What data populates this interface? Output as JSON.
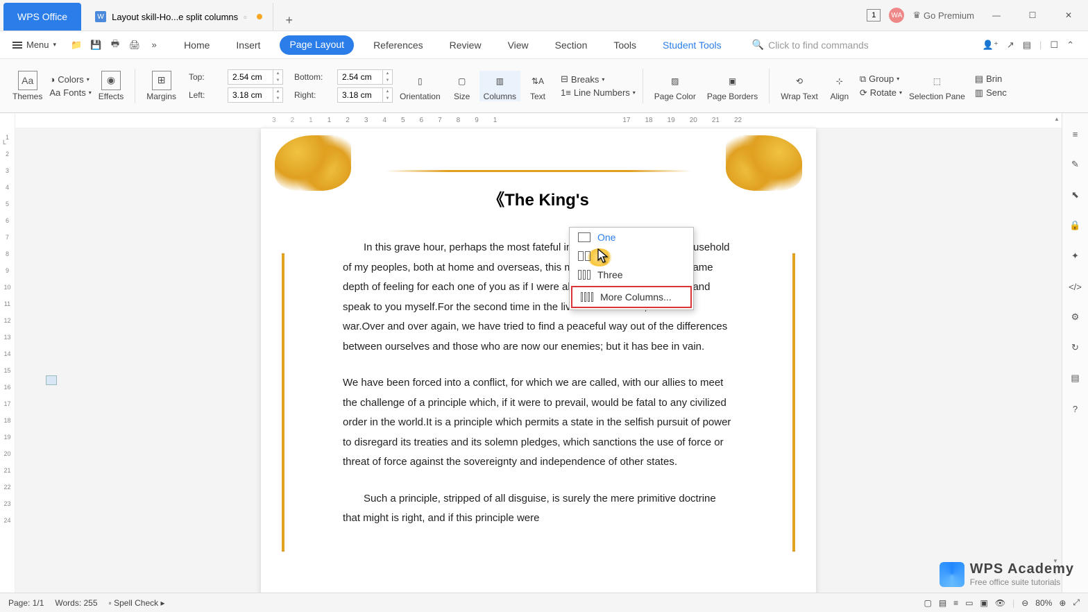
{
  "title_bar": {
    "app_name": "WPS Office",
    "doc_tab": "Layout skill-Ho...e split columns",
    "doc_icon_letter": "W",
    "add_tab": "+",
    "view_badge": "1",
    "avatar": "WA",
    "premium_label": "Go Premium",
    "win_min": "—",
    "win_max": "☐",
    "win_close": "✕"
  },
  "menu": {
    "menu_label": "Menu",
    "tabs": {
      "home": "Home",
      "insert": "Insert",
      "page_layout": "Page Layout",
      "references": "References",
      "review": "Review",
      "view": "View",
      "section": "Section",
      "tools": "Tools",
      "student": "Student Tools"
    },
    "search_placeholder": "Click to find commands"
  },
  "ribbon": {
    "themes": "Themes",
    "colors": "Colors",
    "fonts": "Fonts",
    "effects": "Effects",
    "margins": "Margins",
    "top_lbl": "Top:",
    "top_val": "2.54 cm",
    "bottom_lbl": "Bottom:",
    "bottom_val": "2.54 cm",
    "left_lbl": "Left:",
    "left_val": "3.18 cm",
    "right_lbl": "Right:",
    "right_val": "3.18 cm",
    "orientation": "Orientation",
    "size": "Size",
    "columns": "Columns",
    "text": "Text",
    "breaks": "Breaks",
    "line_numbers": "Line Numbers",
    "page_color": "Page Color",
    "page_borders": "Page Borders",
    "wrap_text": "Wrap Text",
    "align": "Align",
    "group": "Group",
    "rotate": "Rotate",
    "selection_pane": "Selection Pane",
    "bring": "Brin",
    "send": "Senc"
  },
  "hruler": [
    "3",
    "2",
    "1",
    "1",
    "2",
    "3",
    "4",
    "5",
    "6",
    "7",
    "8",
    "9",
    "1",
    "17",
    "18",
    "19",
    "20",
    "21",
    "22"
  ],
  "vruler": [
    "1",
    "2",
    "3",
    "4",
    "5",
    "6",
    "7",
    "8",
    "9",
    "10",
    "11",
    "12",
    "13",
    "14",
    "15",
    "16",
    "17",
    "18",
    "19",
    "20",
    "21",
    "22",
    "23",
    "24"
  ],
  "dropdown": {
    "one": "One",
    "two_hidden": "",
    "three": "Three",
    "more": "More Columns..."
  },
  "document": {
    "title": "《The King's",
    "p1": "In this grave hour, perhaps the most fateful in history, I send to every household of my peoples, both at home and overseas, this message, spoken with the same depth of feeling for each one of you as if I were able to cross your threshold and speak to you myself.For the second time in the lives of most of us, we are at war.Over and over again, we have tried to find a peaceful way out of the differences between ourselves and those who are now our enemies; but it has bee in vain.",
    "p2": "We have been forced into a conflict, for which we are called, with our allies to meet the challenge of a principle which, if it were to prevail, would be fatal to any civilized order in the world.It is a principle which permits a state in the selfish pursuit of power to disregard its treaties and its solemn pledges, which sanctions the use of force or threat of force against the sovereignty and independence of other states.",
    "p3": "Such a principle, stripped of all disguise, is surely the mere primitive doctrine that might is right, and if this principle were"
  },
  "status": {
    "page": "Page: 1/1",
    "words": "Words: 255",
    "spell": "Spell Check",
    "zoom": "80%"
  },
  "watermark": {
    "brand": "WPS Academy",
    "tagline": "Free office suite tutorials"
  }
}
